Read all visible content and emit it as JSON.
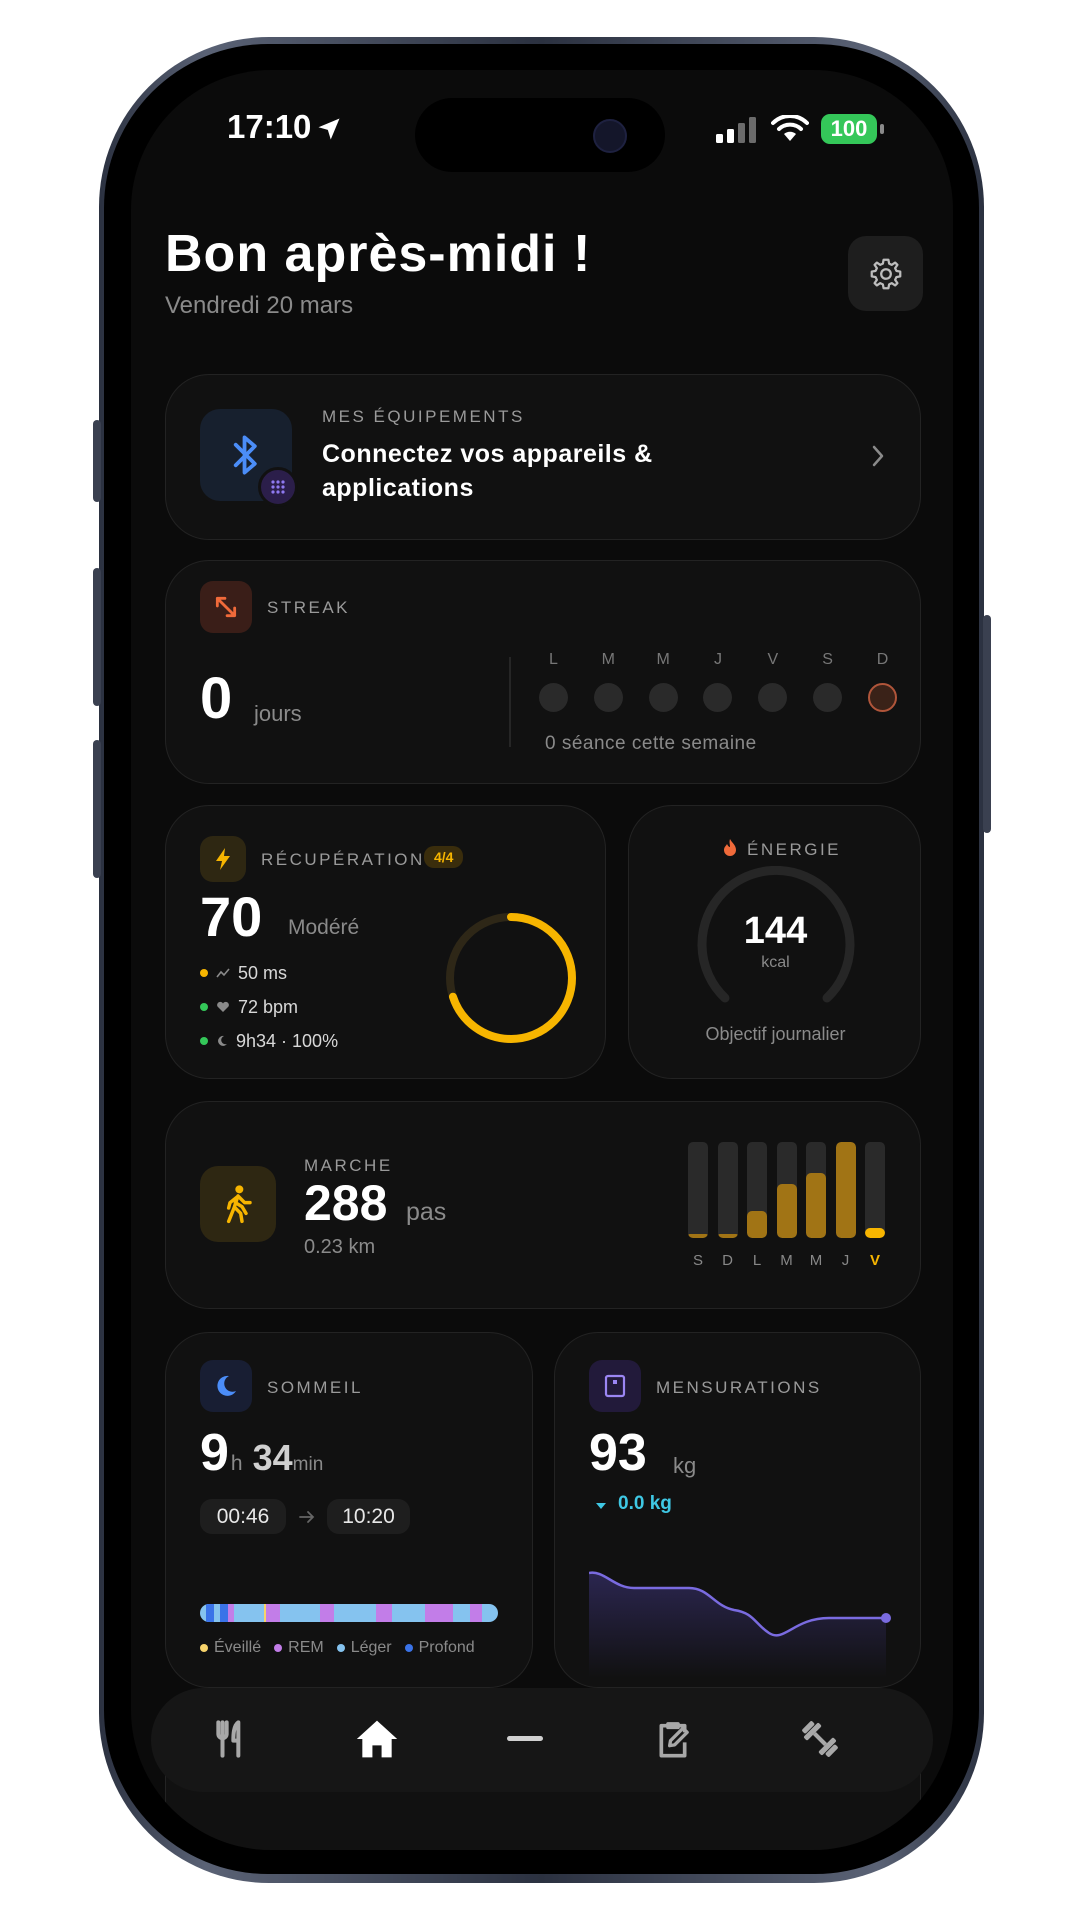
{
  "status_bar": {
    "time": "17:10",
    "battery": "100"
  },
  "header": {
    "greeting": "Bon après-midi !",
    "date": "Vendredi 20 mars"
  },
  "equipment": {
    "label": "MES ÉQUIPEMENTS",
    "title_line1": "Connectez vos appareils &",
    "title_line2": "applications"
  },
  "streak": {
    "label": "STREAK",
    "value": "0",
    "unit": "jours",
    "days": [
      "L",
      "M",
      "M",
      "J",
      "V",
      "S",
      "D"
    ],
    "caption": "0 séance cette semaine"
  },
  "recovery": {
    "label": "RÉCUPÉRATION",
    "badge": "4/4",
    "value": "70",
    "status": "Modéré",
    "hrv": "50 ms",
    "hr": "72 bpm",
    "sleep": "9h34 · 100%",
    "ring_percent": 70
  },
  "energy": {
    "label": "ÉNERGIE",
    "value": "144",
    "unit": "kcal",
    "caption": "Objectif journalier"
  },
  "walk": {
    "label": "MARCHE",
    "value": "288",
    "unit": "pas",
    "distance": "0.23 km",
    "days": [
      "S",
      "D",
      "L",
      "M",
      "M",
      "J",
      "V"
    ],
    "bar_fractions": [
      0.04,
      0.04,
      0.28,
      0.56,
      0.68,
      1.0,
      0.1
    ]
  },
  "sleep": {
    "label": "SOMMEIL",
    "hours": "9",
    "h_unit": "h",
    "minutes": "34",
    "m_unit": "min",
    "start": "00:46",
    "end": "10:20",
    "legend": [
      "Éveillé",
      "REM",
      "Léger",
      "Profond"
    ]
  },
  "measurements": {
    "label": "MENSURATIONS",
    "value": "93",
    "unit": "kg",
    "delta": "0.0 kg"
  },
  "colors": {
    "accent_yellow": "#f7b500",
    "purple": "#7a6be0",
    "cyan": "#3fc8e4",
    "green": "#34c759"
  },
  "nav": [
    "fork-knife-icon",
    "home-icon",
    "minus-icon",
    "clipboard-edit-icon",
    "dumbbell-icon"
  ]
}
